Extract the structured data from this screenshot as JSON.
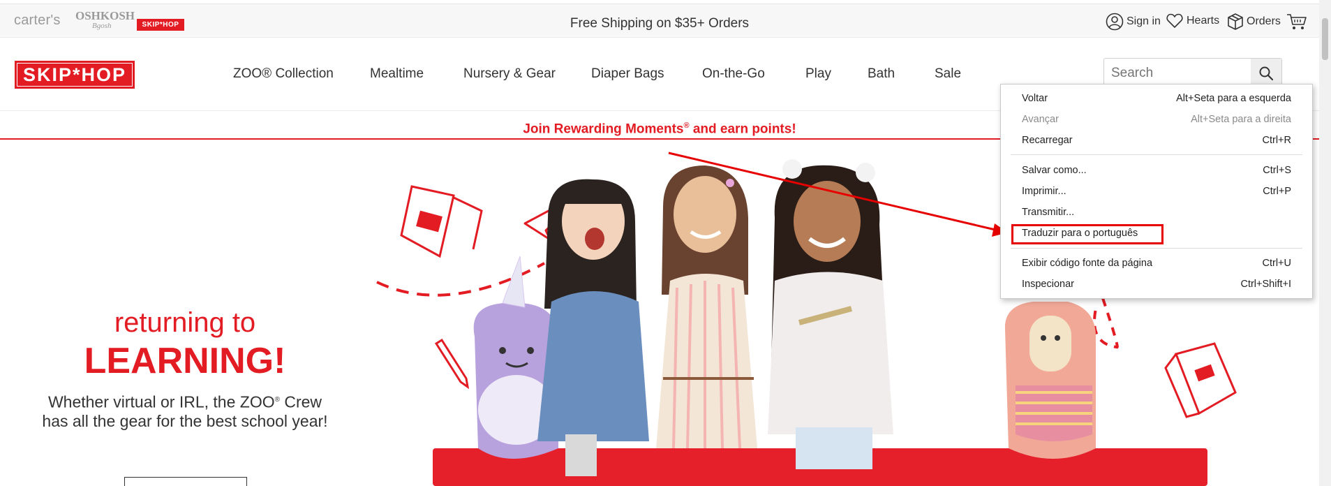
{
  "topbar": {
    "brands": [
      "carter's",
      "OSHKOSH",
      "Bgosh",
      "SKIP*HOP"
    ],
    "promo": "Free Shipping on $35+ Orders",
    "sign_in": "Sign in",
    "hearts": "Hearts",
    "orders": "Orders"
  },
  "header": {
    "logo": "SKIP*HOP",
    "nav": [
      "ZOO® Collection",
      "Mealtime",
      "Nursery & Gear",
      "Diaper Bags",
      "On-the-Go",
      "Play",
      "Bath",
      "Sale"
    ],
    "search_placeholder": "Search"
  },
  "rewards": {
    "text_before": "Join Rewarding Moments",
    "reg": "®",
    "text_after": " and earn points!"
  },
  "hero": {
    "line1": "returning to",
    "line2": "LEARNING!",
    "body_1": "Whether virtual or IRL, the ZOO",
    "reg": "®",
    "body_2": " Crew has all the gear for the best school year!"
  },
  "context_menu": {
    "items": [
      {
        "label": "Voltar",
        "shortcut": "Alt+Seta para a esquerda",
        "disabled": false
      },
      {
        "label": "Avançar",
        "shortcut": "Alt+Seta para a direita",
        "disabled": true
      },
      {
        "label": "Recarregar",
        "shortcut": "Ctrl+R",
        "disabled": false
      },
      {
        "label": "Salvar como...",
        "shortcut": "Ctrl+S",
        "disabled": false
      },
      {
        "label": "Imprimir...",
        "shortcut": "Ctrl+P",
        "disabled": false
      },
      {
        "label": "Transmitir...",
        "shortcut": "",
        "disabled": false
      },
      {
        "label": "Traduzir para o português",
        "shortcut": "",
        "disabled": false
      },
      {
        "label": "Exibir código fonte da página",
        "shortcut": "Ctrl+U",
        "disabled": false
      },
      {
        "label": "Inspecionar",
        "shortcut": "Ctrl+Shift+I",
        "disabled": false
      }
    ]
  },
  "colors": {
    "brand_red": "#e31b23",
    "annotation_red": "#e60000"
  }
}
